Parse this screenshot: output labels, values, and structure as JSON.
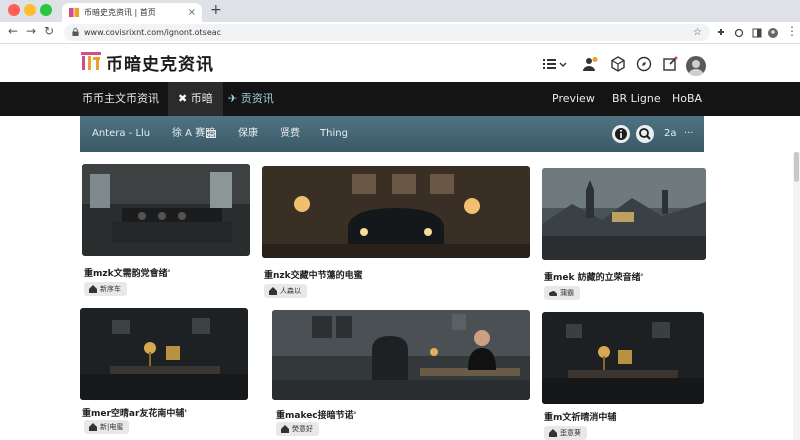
{
  "browser": {
    "tab_title": "币暗史克资讯 | 首页",
    "url": "www.covisrixnt.com/ignont.otseac"
  },
  "site": {
    "logo_text": "币暗史克资讯"
  },
  "main_nav": {
    "items": [
      {
        "label": "币币主文币资讯"
      },
      {
        "label": "币暗",
        "icon": "pin-icon"
      },
      {
        "label": "贡资讯",
        "icon": "plane-icon"
      }
    ],
    "right_items": [
      {
        "label": "Preview"
      },
      {
        "label": "BR Ligne"
      },
      {
        "label": "HoBA"
      }
    ]
  },
  "sub_nav": {
    "items": [
      {
        "label": "Antera - Llu"
      },
      {
        "label": "徐 A 赛暗"
      },
      {
        "label": "保康"
      },
      {
        "label": "贤费"
      },
      {
        "label": "Thing"
      }
    ],
    "count_label": "2a",
    "more_label": "···"
  },
  "cards": [
    {
      "title": "重mzk文需韵党會绪'",
      "tag": "新序车",
      "tag_icon": "home-icon"
    },
    {
      "title": "重nzk交藏中节蕩的电蜜",
      "tag": "人森以",
      "tag_icon": "home-icon"
    },
    {
      "title": "重mek 訪藏的立荣音绪'",
      "tag": "蒲霸",
      "tag_icon": "cloud-icon"
    },
    {
      "title": "重mer空晴ar友花南中辅'",
      "tag": "新|电蜜",
      "tag_icon": "home-icon"
    },
    {
      "title": "重makec接暗节诺'",
      "tag": "熒意好",
      "tag_icon": "home-icon"
    },
    {
      "title": "重m文祈晴消中辅",
      "tag": "歪意葵",
      "tag_icon": "home-icon"
    }
  ],
  "colors": {
    "nav_bg": "#141414",
    "subnav_bg": "#46697a",
    "accent_logo_1": "#d64b8c",
    "accent_logo_2": "#e9a12b"
  }
}
